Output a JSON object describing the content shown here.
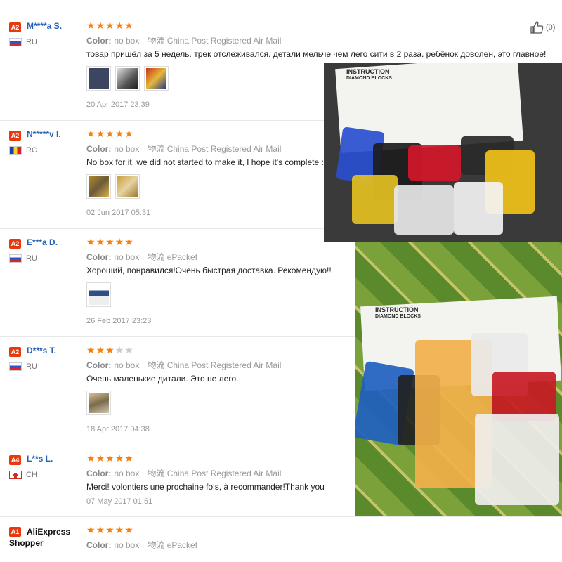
{
  "labels": {
    "color_key": "Color:",
    "helpful_count": "(0)"
  },
  "reviews": [
    {
      "level": "A2",
      "name": "M****a S.",
      "country": "RU",
      "rating": 5,
      "color": "no box",
      "shipping": "物流 China Post Registered Air Mail",
      "text": "товар пришёл за 5 недель. трек отслеживался. детали мельче чем лего сити в 2 раза. ребёнок доволен, это главное!",
      "photos": 3,
      "date": "20 Apr 2017 23:39"
    },
    {
      "level": "A2",
      "name": "N*****v I.",
      "country": "RO",
      "rating": 5,
      "color": "no box",
      "shipping": "物流 China Post Registered Air Mail",
      "text": "No box for it, we did not started to make it, I hope it's complete :)",
      "photos": 2,
      "date": "02 Jun 2017 05:31"
    },
    {
      "level": "A2",
      "name": "E***a D.",
      "country": "RU",
      "rating": 5,
      "color": "no box",
      "shipping": "物流 ePacket",
      "text": "Хороший, понравился!Очень быстрая доставка. Рекомендую!!",
      "photos": 1,
      "date": "26 Feb 2017 23:23"
    },
    {
      "level": "A2",
      "name": "D***s T.",
      "country": "RU",
      "rating": 3,
      "color": "no box",
      "shipping": "物流 China Post Registered Air Mail",
      "text": "Очень маленькие дитали. Это не лего.",
      "photos": 1,
      "date": "18 Apr 2017 04:38"
    },
    {
      "level": "A4",
      "name": "L**s L.",
      "country": "CH",
      "rating": 5,
      "color": "no box",
      "shipping": "物流 China Post Registered Air Mail",
      "text": "Merci! volontiers une prochaine fois, à recommander!Thank you",
      "photos": 0,
      "date": "07 May 2017 01:51"
    },
    {
      "level": "A1",
      "name": "AliExpress",
      "name2": "Shopper",
      "country": "",
      "rating": 5,
      "color": "no box",
      "shipping": "物流 ePacket",
      "text": "",
      "photos": 0,
      "date": ""
    }
  ],
  "photo_text": {
    "manual_title_1": "INSTRUCTION",
    "manual_title_2": "DIAMOND BLOCKS"
  },
  "colors": {
    "star": "#f77e0b",
    "name": "#2461b4",
    "level_badge": "#e8380d"
  }
}
